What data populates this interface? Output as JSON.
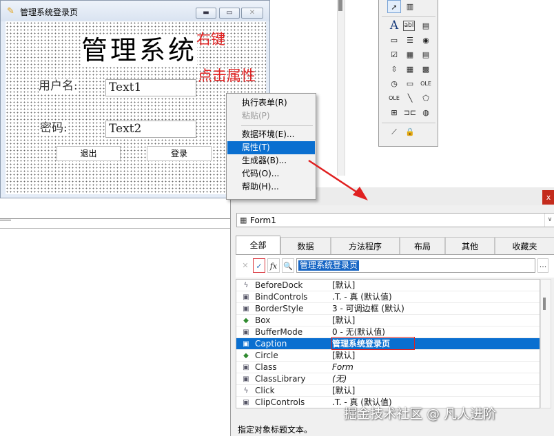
{
  "form_window": {
    "title": "管理系统登录页",
    "title_icon": "fox-pro-icon",
    "buttons": {
      "minimize": "▬",
      "maximize": "▭",
      "close": "✕"
    },
    "heading": "管理系统",
    "username_label": "用户名:",
    "password_label": "密码:",
    "textbox_1": "Text1",
    "textbox_2": "Text2",
    "exit_button": "退出",
    "login_button": "登录"
  },
  "annotations": {
    "line_1": "右键",
    "line_2": "点击属性",
    "color": "#e02020"
  },
  "toolbox": {
    "tools": [
      "pointer-icon",
      "class-library-icon",
      "label-icon",
      "textbox-icon",
      "editbox-icon",
      "command-button-icon",
      "command-group-icon",
      "option-group-icon",
      "checkbox-icon",
      "combobox-icon",
      "listbox-icon",
      "spinner-icon",
      "grid-icon",
      "image-icon",
      "timer-icon",
      "pageframe-icon",
      "ole-container-icon",
      "ole-bound-icon",
      "line-icon",
      "shape-icon",
      "container-icon",
      "separator-icon",
      "hyperlink-icon",
      "builder-lock-icon",
      "lock-icon"
    ]
  },
  "context_menu": {
    "items": [
      {
        "label": "执行表单(R)",
        "disabled": false
      },
      {
        "label": "粘贴(P)",
        "disabled": true
      },
      {
        "label": "数据环境(E)...",
        "disabled": false
      },
      {
        "label": "属性(T)",
        "disabled": false,
        "active": true
      },
      {
        "label": "生成器(B)...",
        "disabled": false
      },
      {
        "label": "代码(O)...",
        "disabled": false
      },
      {
        "label": "帮助(H)...",
        "disabled": false
      }
    ]
  },
  "properties": {
    "close": "x",
    "object": "Form1",
    "object_dropdown_arrow": "∨",
    "tabs": [
      "全部",
      "数据",
      "方法程序",
      "布局",
      "其他",
      "收藏夹"
    ],
    "active_tab": "全部",
    "edit_buttons": {
      "cancel": "✕",
      "accept": "✓",
      "fx": "fx",
      "zoom": "🔍",
      "more": "..."
    },
    "edit_value": "管理系统登录页",
    "rows": [
      {
        "icon": "event-icon",
        "name": "BeforeDock",
        "value": "[默认]"
      },
      {
        "icon": "property-icon",
        "name": "BindControls",
        "value": ".T. - 真 (默认值)"
      },
      {
        "icon": "property-icon",
        "name": "BorderStyle",
        "value": "3 - 可调边框 (默认)"
      },
      {
        "icon": "method-icon",
        "name": "Box",
        "value": "[默认]"
      },
      {
        "icon": "property-icon",
        "name": "BufferMode",
        "value": "0 - 无(默认值)"
      },
      {
        "icon": "property-icon",
        "name": "Caption",
        "value": "管理系统登录页",
        "selected": true
      },
      {
        "icon": "method-icon",
        "name": "Circle",
        "value": "[默认]"
      },
      {
        "icon": "property-icon",
        "name": "Class",
        "value": "Form",
        "italic": true
      },
      {
        "icon": "property-icon",
        "name": "ClassLibrary",
        "value": "(无)",
        "italic": true
      },
      {
        "icon": "event-icon",
        "name": "Click",
        "value": "[默认]"
      },
      {
        "icon": "property-icon",
        "name": "ClipControls",
        "value": ".T. - 真 (默认值)"
      }
    ],
    "status": "指定对象标题文本。"
  },
  "watermark": "掘金技术社区 @ 凡人进阶",
  "colors": {
    "selection": "#0a6fd0",
    "annotation_red": "#e02020",
    "titlebar": "#d9e3f1"
  }
}
